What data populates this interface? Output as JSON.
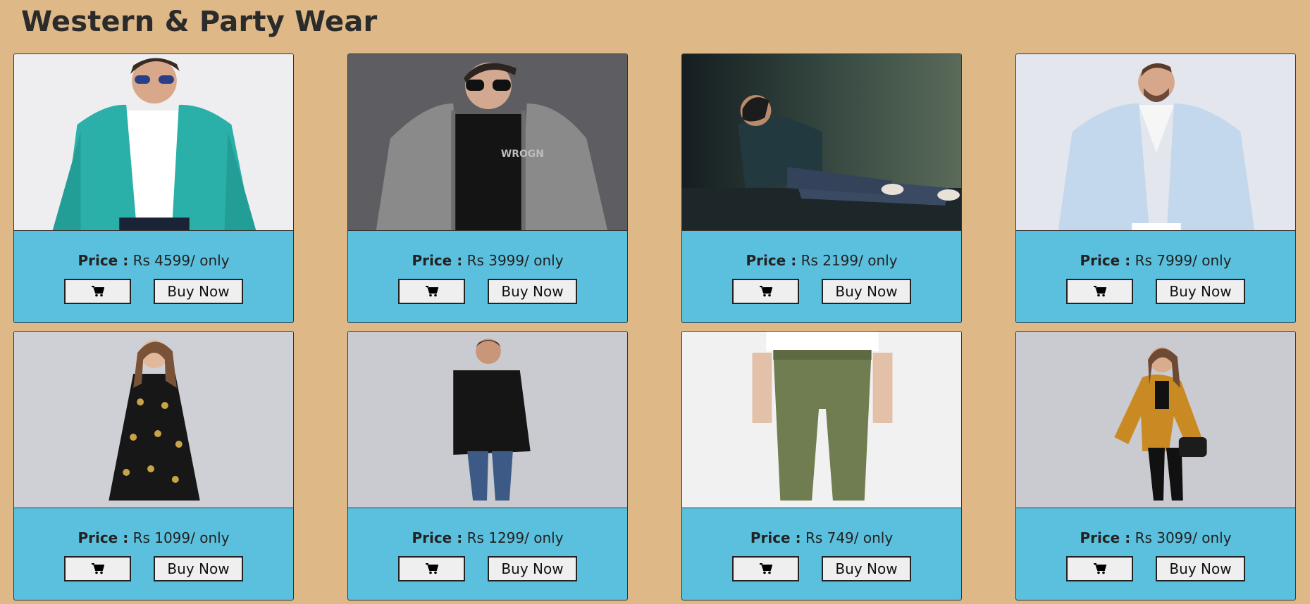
{
  "page": {
    "title": "Western & Party Wear"
  },
  "labels": {
    "price_label": "Price :",
    "buy_now": "Buy Now",
    "cart_icon": "shopping-cart-icon"
  },
  "products": [
    {
      "price": "Rs 4599/ only",
      "photo": "man-teal-bomber-jacket-sunglasses"
    },
    {
      "price": "Rs 3999/ only",
      "photo": "man-grey-hoodie-sunglasses"
    },
    {
      "price": "Rs 2199/ only",
      "photo": "man-check-shirt-seated-jeans"
    },
    {
      "price": "Rs 7999/ only",
      "photo": "man-light-blue-blazer"
    },
    {
      "price": "Rs 1099/ only",
      "photo": "woman-black-printed-maxi-dress"
    },
    {
      "price": "Rs 1299/ only",
      "photo": "woman-black-tunic-jeans"
    },
    {
      "price": "Rs 749/ only",
      "photo": "olive-paperbag-trousers"
    },
    {
      "price": "Rs 3099/ only",
      "photo": "woman-mustard-shrug-black-pants"
    }
  ]
}
